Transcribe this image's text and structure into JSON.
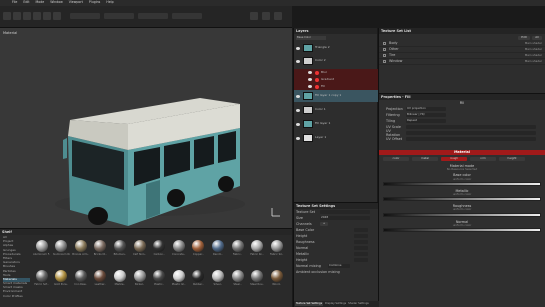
{
  "menubar": {
    "items": [
      "File",
      "Edit",
      "Mode",
      "Window",
      "Viewport",
      "Plugins",
      "Help"
    ]
  },
  "viewport": {
    "label": "Material"
  },
  "shelf": {
    "title": "Shelf",
    "categories": [
      "All",
      "Project",
      "Alphas",
      "Grunges",
      "Procedurals",
      "Filters",
      "Generators",
      "Brushes",
      "Particles",
      "Tools",
      "Materials",
      "Smart materials",
      "Smart masks",
      "Environment",
      "Color Profiles"
    ],
    "selected_category": 10,
    "materials": [
      {
        "label": "Aluminium F..",
        "color": "#9a9a9a"
      },
      {
        "label": "Aluminium Ro..",
        "color": "#8c8c8c"
      },
      {
        "label": "Bronze Arm..",
        "color": "#8a7a5a"
      },
      {
        "label": "Bricks Ol..",
        "color": "#7a6a60"
      },
      {
        "label": "Bitumen..",
        "color": "#555"
      },
      {
        "label": "Calf Skin..",
        "color": "#7a6a55"
      },
      {
        "label": "Carbon..",
        "color": "#333"
      },
      {
        "label": "Concrete..",
        "color": "#888"
      },
      {
        "label": "Copper..",
        "color": "#a0603a"
      },
      {
        "label": "Denim..",
        "color": "#506a8a"
      },
      {
        "label": "Fabric..",
        "color": "#777"
      },
      {
        "label": "Fabric Kn..",
        "color": "#aaa"
      },
      {
        "label": "Fabric Sil..",
        "color": "#999"
      },
      {
        "label": "Fabric Sof..",
        "color": "#666"
      },
      {
        "label": "Gold Pure..",
        "color": "#b09040"
      },
      {
        "label": "Iron Raw..",
        "color": "#5a5a5a"
      },
      {
        "label": "Leather..",
        "color": "#6a4a3a"
      },
      {
        "label": "Marble..",
        "color": "#ccc"
      },
      {
        "label": "Nickel..",
        "color": "#9a9a9a"
      },
      {
        "label": "Plastic..",
        "color": "#4a4a4a"
      },
      {
        "label": "Plastic Gl..",
        "color": "#cfcfcf"
      },
      {
        "label": "Rubber..",
        "color": "#2a2a2a"
      },
      {
        "label": "Silver..",
        "color": "#bbb"
      },
      {
        "label": "Steel..",
        "color": "#8a8a8a"
      },
      {
        "label": "Steel Rou..",
        "color": "#777"
      },
      {
        "label": "Wood..",
        "color": "#7a5a3a"
      }
    ]
  },
  "layers": {
    "title": "Layers",
    "blend": "Base Color",
    "rows": [
      {
        "label": "Triangle 2",
        "type": "folder"
      },
      {
        "label": "Color 2",
        "type": "mask"
      },
      {
        "label": "Blur",
        "type": "effect"
      },
      {
        "label": "Gradient",
        "type": "effect"
      },
      {
        "label": "Fill",
        "type": "effect"
      },
      {
        "label": "Fill layer 1 copy 1",
        "type": "fill"
      },
      {
        "label": "Color 1",
        "type": "mask"
      },
      {
        "label": "Fill layer 1",
        "type": "fill"
      },
      {
        "label": "Layer 1",
        "type": "paint"
      }
    ]
  },
  "texture_set_list": {
    "title": "Texture Set List",
    "buttons": [
      "Edit",
      "All"
    ],
    "sets": [
      {
        "name": "Body",
        "shader": "Main shader"
      },
      {
        "name": "Other",
        "shader": "Main shader"
      },
      {
        "name": "Tire",
        "shader": "Main shader"
      },
      {
        "name": "Window",
        "shader": "Main shader"
      }
    ]
  },
  "properties": {
    "title": "Properties - Fill",
    "section": "Fill",
    "projection_label": "Projection",
    "projection_value": "UV projection",
    "filtering_label": "Filtering",
    "filtering_value": "Bilinear | HQ",
    "tiling_label": "Tiling",
    "tiling_value": "Repeat",
    "uv_labels": [
      "UV Scale",
      "UV Rotation",
      "UV Offset"
    ],
    "material_header": "Material",
    "channel_buttons": [
      "color",
      "metal",
      "rough",
      "nrm",
      "height"
    ],
    "active_channel": 2,
    "fields": [
      {
        "label": "Material mode",
        "value": "No Resource Selected"
      },
      {
        "label": "Base color",
        "value": "uniform color"
      },
      {
        "label": "Metallic",
        "value": "uniform color"
      },
      {
        "label": "Roughness",
        "value": "uniform color"
      },
      {
        "label": "Normal",
        "value": "uniform color"
      }
    ]
  },
  "texset_settings": {
    "title": "Texture Set Settings",
    "list_label": "Texture Set",
    "size_label": "Size",
    "size_value": "2048",
    "channels_label": "Channels",
    "channels": [
      "Base Color",
      "Height",
      "Roughness",
      "Normal",
      "Metallic",
      "Height"
    ],
    "normal_label": "Normal mixing",
    "normal_value": "Combine",
    "ao_label": "Ambient occlusion mixing",
    "tabs": [
      "Texture Set Settings",
      "Display Settings",
      "Shader Settings"
    ]
  },
  "colors": {
    "accent_red": "#a11a1a",
    "teal_bus": "#5fa3a5",
    "selection": "#345564"
  }
}
